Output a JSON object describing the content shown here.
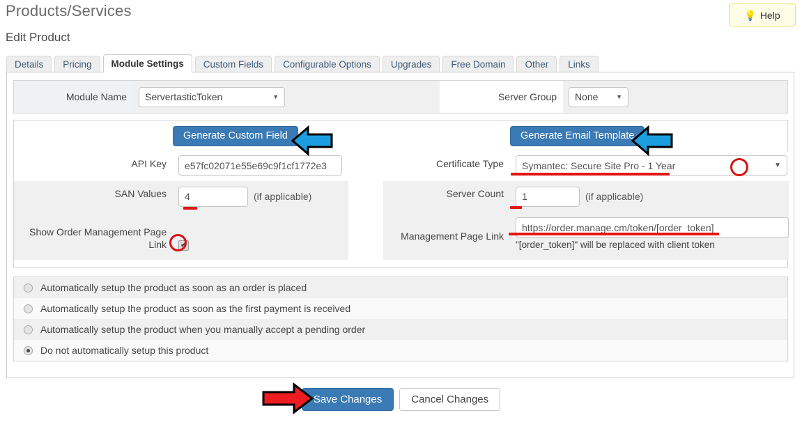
{
  "header": {
    "title": "Products/Services",
    "subtitle": "Edit Product",
    "help_label": "Help",
    "help_icon": "lightbulb-icon"
  },
  "tabs": [
    {
      "label": "Details",
      "active": false
    },
    {
      "label": "Pricing",
      "active": false
    },
    {
      "label": "Module Settings",
      "active": true
    },
    {
      "label": "Custom Fields",
      "active": false
    },
    {
      "label": "Configurable Options",
      "active": false
    },
    {
      "label": "Upgrades",
      "active": false
    },
    {
      "label": "Free Domain",
      "active": false
    },
    {
      "label": "Other",
      "active": false
    },
    {
      "label": "Links",
      "active": false
    }
  ],
  "module_row": {
    "module_name_label": "Module Name",
    "module_name_value": "ServertasticToken",
    "server_group_label": "Server Group",
    "server_group_value": "None",
    "caret_icon": "chevron-down-icon"
  },
  "left_column": {
    "generate_custom_field_label": "Generate Custom Field",
    "api_key_label": "API Key",
    "api_key_value": "e57fc02071e55e69c9f1cf1772e3",
    "san_values_label": "SAN Values",
    "san_values_value": "4",
    "san_values_hint": "(if applicable)",
    "show_link_label": "Show Order Management Page Link",
    "show_link_checked": true,
    "check_icon": "checkmark-icon"
  },
  "right_column": {
    "generate_email_template_label": "Generate Email Template",
    "certificate_type_label": "Certificate Type",
    "certificate_type_value": "Symantec: Secure Site Pro - 1 Year",
    "server_count_label": "Server Count",
    "server_count_value": "1",
    "server_count_hint": "(if applicable)",
    "management_link_label": "Management Page Link",
    "management_link_value": "https://order.manage.cm/token/[order_token]",
    "management_link_note": "\"[order_token]\" will be replaced with client token",
    "caret_icon": "chevron-down-icon"
  },
  "setup_options": [
    {
      "label": "Automatically setup the product as soon as an order is placed",
      "selected": false
    },
    {
      "label": "Automatically setup the product as soon as the first payment is received",
      "selected": false
    },
    {
      "label": "Automatically setup the product when you manually accept a pending order",
      "selected": false
    },
    {
      "label": "Do not automatically setup this product",
      "selected": true
    }
  ],
  "footer": {
    "save_label": "Save Changes",
    "cancel_label": "Cancel Changes"
  },
  "annotations": {
    "arrow_blue_color": "#1b9ee0",
    "arrow_red_color": "#ee1c20",
    "outline_color": "#000000",
    "highlight_color": "#e31616",
    "blue_arrow_custom_field": "left-pointing-arrow",
    "blue_arrow_email_template": "left-pointing-arrow",
    "red_arrow_save": "right-pointing-arrow"
  }
}
